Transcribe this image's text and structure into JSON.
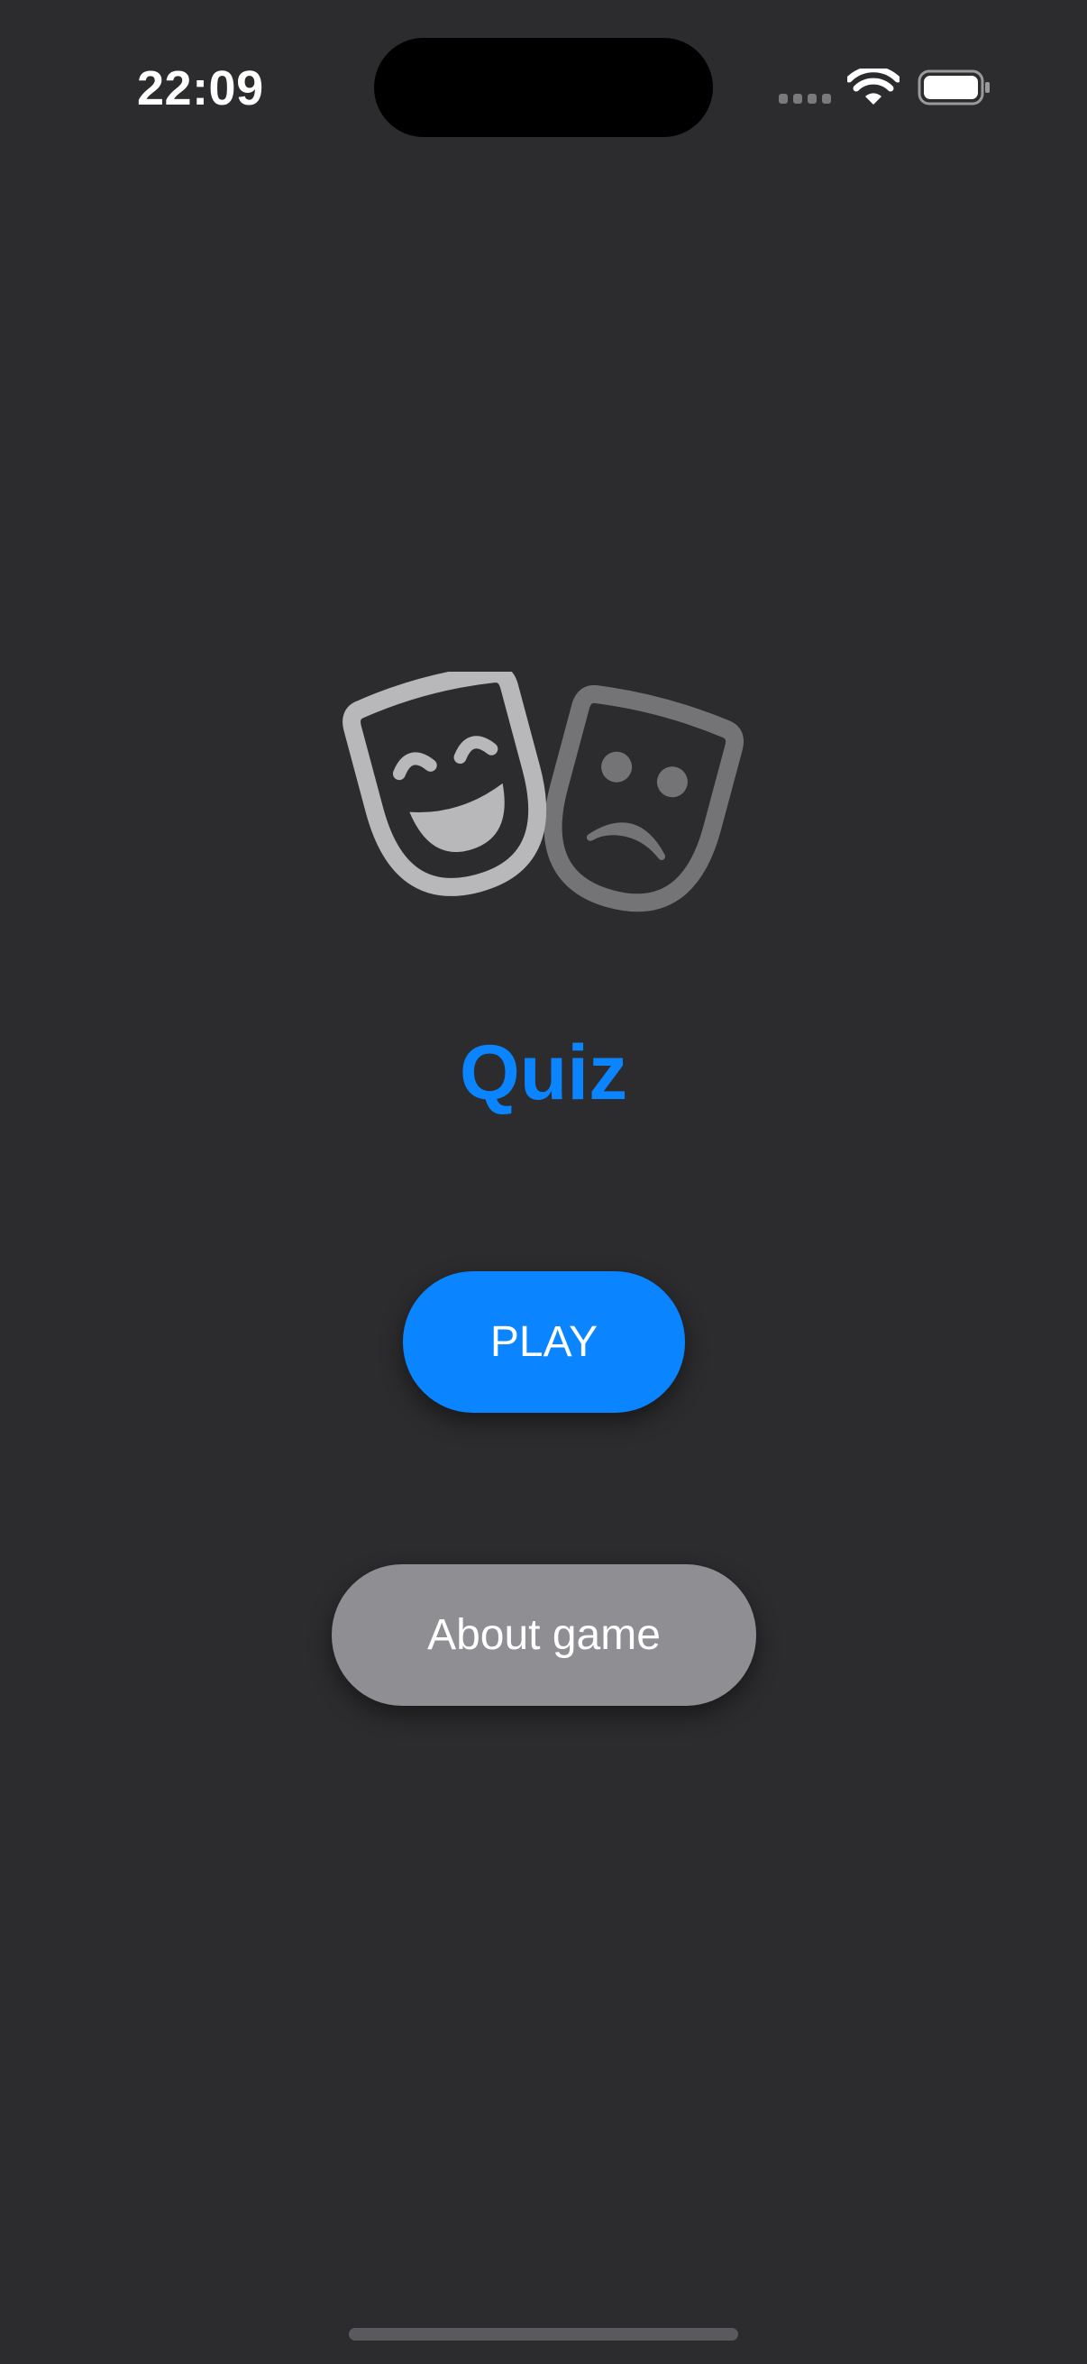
{
  "status_bar": {
    "time": "22:09",
    "icons": [
      "cellular-signal-icon",
      "wifi-icon",
      "battery-icon"
    ]
  },
  "main": {
    "logo_icon": "theater-masks-icon",
    "title": "Quiz",
    "play_label": "PLAY",
    "about_label": "About game"
  },
  "colors": {
    "background": "#2c2c2e",
    "accent": "#0a84ff",
    "secondary_button": "#8e8e93",
    "mask_light": "#b8b8bb",
    "mask_dark": "#747476"
  }
}
